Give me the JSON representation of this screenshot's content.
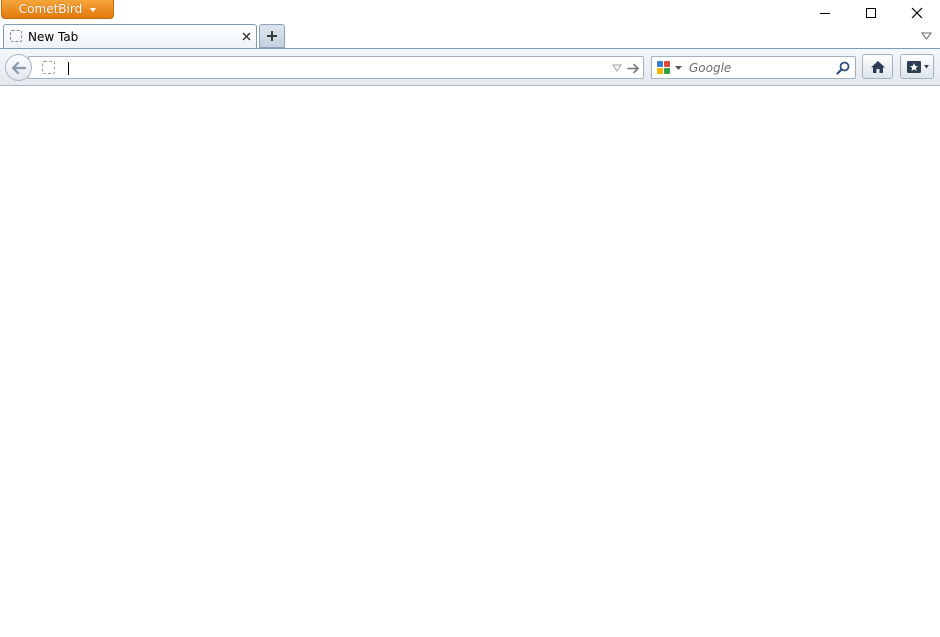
{
  "app": {
    "menu_label": "CometBird",
    "accent_color": "#e98a1a"
  },
  "window_controls": {
    "minimize": "minimize-icon",
    "maximize": "maximize-icon",
    "close": "close-icon"
  },
  "tabs": [
    {
      "label": "New Tab",
      "active": true
    }
  ],
  "navbar": {
    "url_value": "",
    "search_placeholder": "Google",
    "search_engine_icon": "google-icon"
  }
}
